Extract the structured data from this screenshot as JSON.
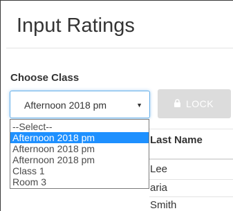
{
  "page": {
    "title": "Input Ratings"
  },
  "class_selector": {
    "label": "Choose Class",
    "selected": "Afternoon 2018 pm",
    "options": [
      "--Select--",
      "Afternoon 2018 pm",
      "Afternoon 2018 pm",
      "Afternoon 2018 pm",
      "Class 1",
      "Room 3"
    ],
    "highlighted_index": 1
  },
  "lock_button": {
    "label": "LOCK",
    "icon": "lock-icon",
    "state": "disabled"
  },
  "table": {
    "columns": [
      "Last Name"
    ],
    "rows": [
      "Lee",
      "aria",
      "Smith"
    ]
  },
  "colors": {
    "focus_border": "#66afe9",
    "highlight": "#1e90ff",
    "disabled_button": "#dcdcdc"
  }
}
